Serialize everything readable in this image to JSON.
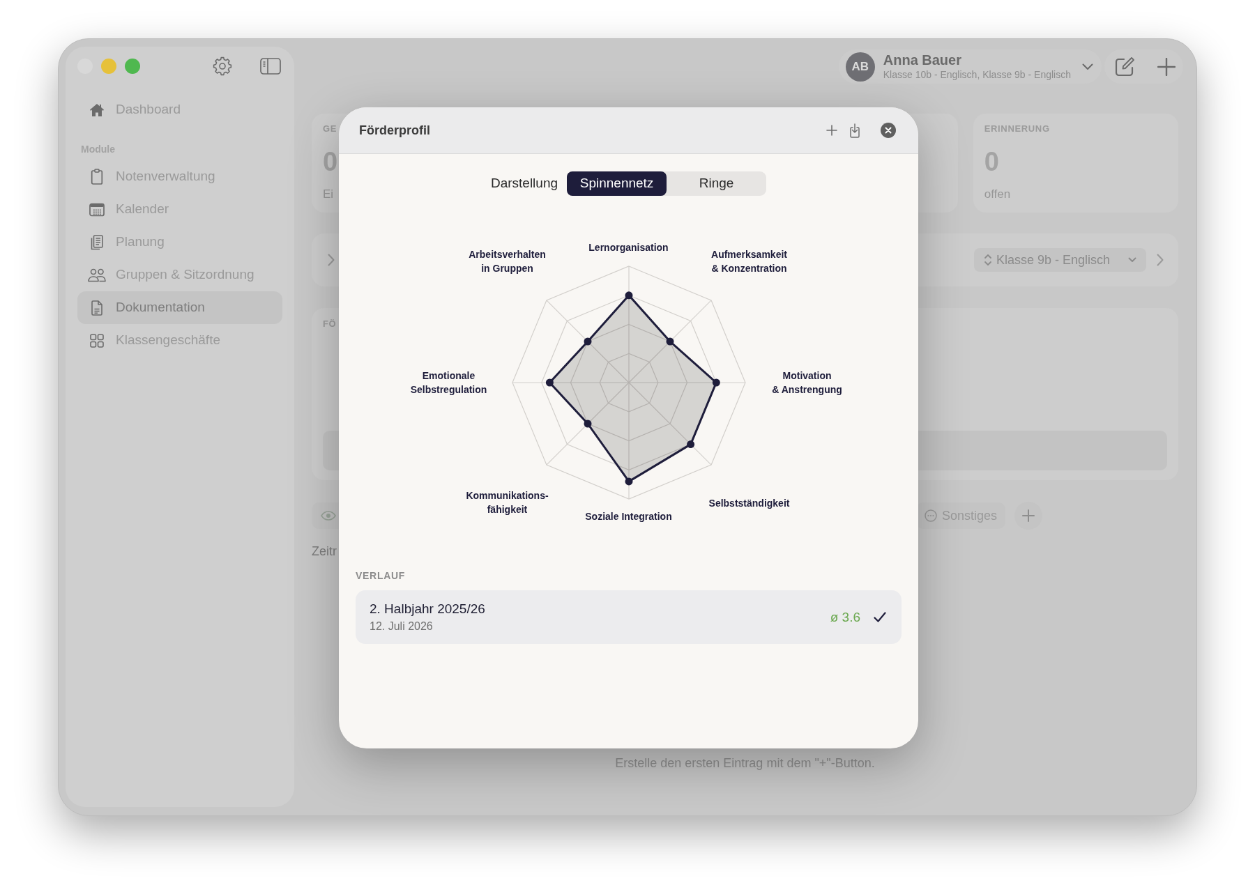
{
  "sidebar": {
    "items": [
      {
        "label": "Dashboard",
        "selected": false
      }
    ],
    "section_title": "Module",
    "module_items": [
      {
        "label": "Notenverwaltung",
        "selected": false
      },
      {
        "label": "Kalender",
        "selected": false
      },
      {
        "label": "Planung",
        "selected": false
      },
      {
        "label": "Gruppen & Sitzordnung",
        "selected": false
      },
      {
        "label": "Dokumentation",
        "selected": true
      },
      {
        "label": "Klassengeschäfte",
        "selected": false
      }
    ]
  },
  "account": {
    "initials": "AB",
    "name": "Anna Bauer",
    "classes": "Klasse 10b - Englisch, Klasse 9b - Englisch"
  },
  "stat_cards": [
    {
      "label": "GE",
      "value": "0",
      "caption": "Ei"
    },
    {
      "label": "ERINNERUNG",
      "value": "0",
      "caption": "offen"
    }
  ],
  "class_picker": {
    "value": "Klasse 9b - Englisch"
  },
  "section": {
    "label": "FÖ"
  },
  "chips": [
    {
      "label": "Sonstiges"
    }
  ],
  "timeline_label": "Zeitr",
  "empty_hint": "Erstelle den ersten Eintrag mit dem \"+\"-Button.",
  "modal": {
    "title": "Förderprofil",
    "view_label": "Darstellung",
    "views": [
      {
        "label": "Spinnennetz",
        "selected": true
      },
      {
        "label": "Ringe",
        "selected": false
      }
    ],
    "radar": {
      "axes": [
        {
          "lines": [
            "Lernorganisation"
          ]
        },
        {
          "lines": [
            "Aufmerksamkeit",
            "& Konzentration"
          ]
        },
        {
          "lines": [
            "Motivation",
            "& Anstrengung"
          ]
        },
        {
          "lines": [
            "Selbstständigkeit"
          ]
        },
        {
          "lines": [
            "Soziale Integration"
          ]
        },
        {
          "lines": [
            "Kommunikations-",
            "fähigkeit"
          ]
        },
        {
          "lines": [
            "Emotionale",
            "Selbstregulation"
          ]
        },
        {
          "lines": [
            "Arbeitsverhalten",
            "in Gruppen"
          ]
        }
      ]
    },
    "history_label": "VERLAUF",
    "history": [
      {
        "title": "2. Halbjahr 2025/26",
        "date": "12. Juli 2026",
        "average": "ø 3.6",
        "selected": true
      }
    ]
  }
}
